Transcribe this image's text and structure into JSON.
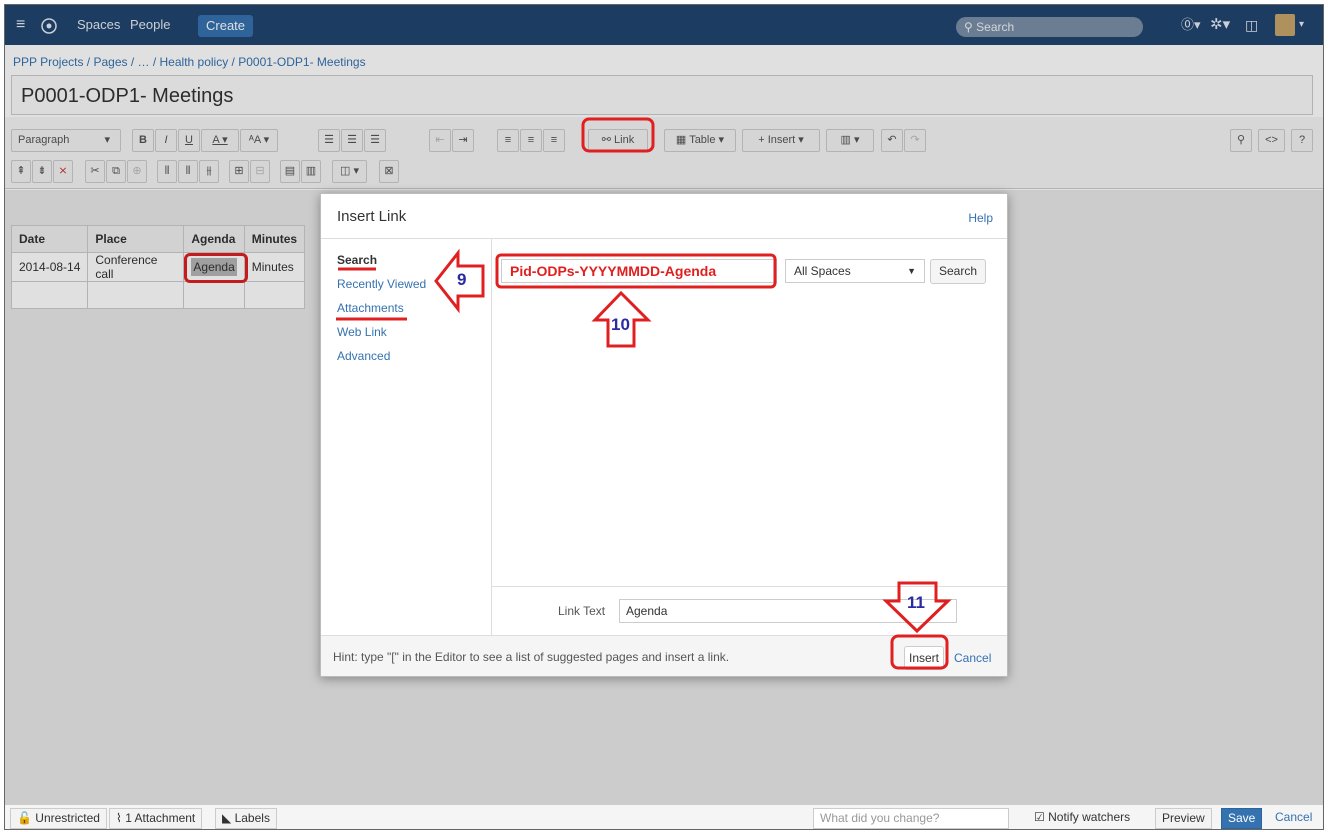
{
  "topbar": {
    "items": [
      "Spaces",
      "People"
    ],
    "create_label": "Create",
    "search_placeholder": "Search"
  },
  "breadcrumb": "PPP Projects / Pages / … / Health policy / P0001-ODP1- Meetings",
  "page_title": "P0001-ODP1- Meetings",
  "toolbar": {
    "paragraph_label": "Paragraph",
    "link_label": "Link",
    "table_label": "Table",
    "insert_label": "Insert"
  },
  "page_table": {
    "headers": [
      "Date",
      "Place",
      "Agenda",
      "Minutes"
    ],
    "rows": [
      [
        "2014-08-14",
        "Conference call",
        "Agenda",
        "Minutes"
      ],
      [
        "",
        "",
        "",
        ""
      ]
    ]
  },
  "dialog": {
    "title": "Insert Link",
    "help": "Help",
    "nav": [
      "Search",
      "Recently Viewed",
      "Attachments",
      "Web Link",
      "Advanced"
    ],
    "search_value": "Pid-ODPs-YYYYMMDD-Agenda",
    "space_option": "All Spaces",
    "search_button": "Search",
    "link_text_label": "Link Text",
    "link_text_value": "Agenda",
    "hint": "Hint: type \"[\" in the Editor to see a list of suggested pages and insert a link.",
    "insert_button": "Insert",
    "cancel": "Cancel"
  },
  "annotations": [
    "9",
    "10",
    "11"
  ],
  "bottombar": {
    "restricted": "Unrestricted",
    "attachments": "1 Attachment",
    "labels": "Labels",
    "change_placeholder": "What did you change?",
    "notify": "Notify watchers",
    "preview": "Preview",
    "save": "Save",
    "cancel": "Cancel"
  },
  "colors": {
    "topbar": "#20456f",
    "accent": "#3572b0",
    "annotation_red": "#e02020",
    "annotation_blue": "#2a2aa5"
  }
}
